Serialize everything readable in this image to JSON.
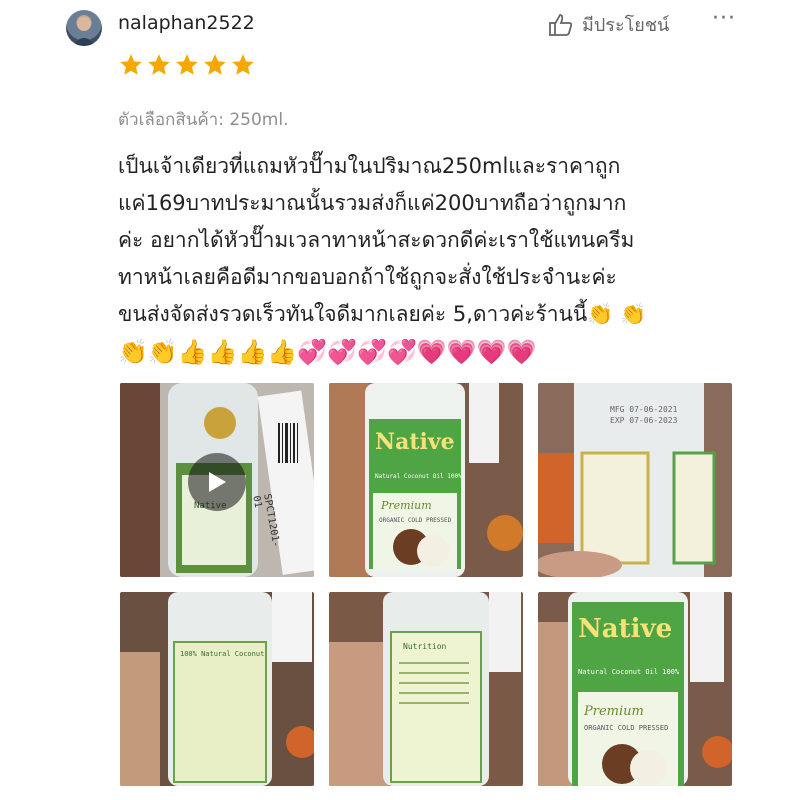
{
  "review": {
    "username": "nalaphan2522",
    "helpful_label": "มีประโยชน์",
    "more_label": "···",
    "rating": 5,
    "variant": "ตัวเลือกสินค้า: 250ml.",
    "text": "เป็นเจ้าเดียวที่แถมหัวปั๊ามในปริมาณ250mlและราคาถูก\nแค่169บาทประมาณนั้นรวมส่งก็แค่200บาทถือว่าถูกมาก\nค่ะ อยากได้หัวปั๊ามเวลาทาหน้าสะดวกดีค่ะเราใช้แทนครีม\nทาหน้าเลยคือดีมากขอบอกถ้าใช้ถูกจะสั่งใช้ประจำนะค่ะ\nขนส่งจัดส่งรวดเร็วทันใจดีมากเลยค่ะ 5,ดาวค่ะร้านนี้👏 👏",
    "emojis": "👏👏👍👍👍👍💞💞💞💞💗💗💗💗"
  },
  "media": {
    "video_label": "Native",
    "items": [
      {
        "type": "video",
        "label_brand": "Native",
        "barcode_text": "SPCT1201-01"
      },
      {
        "type": "photo",
        "brand": "Native",
        "line1": "Natural Coconut Oil 100%",
        "premium": "Premium",
        "sub": "ORGANIC COLD PRESSED"
      },
      {
        "type": "photo",
        "mfg": "MFG 07-06-2021",
        "exp": "EXP 07-06-2023"
      },
      {
        "type": "photo",
        "label": "100% Natural Coconut"
      },
      {
        "type": "photo",
        "label": "Nutrition"
      },
      {
        "type": "photo",
        "brand": "Native",
        "line1": "Natural Coconut Oil 100%",
        "premium": "Premium",
        "sub": "ORGANIC COLD PRESSED"
      }
    ]
  },
  "colors": {
    "star": "#f6a700",
    "accent_green": "#3c9a3c",
    "text": "#222222",
    "muted": "#8e8e8e"
  }
}
